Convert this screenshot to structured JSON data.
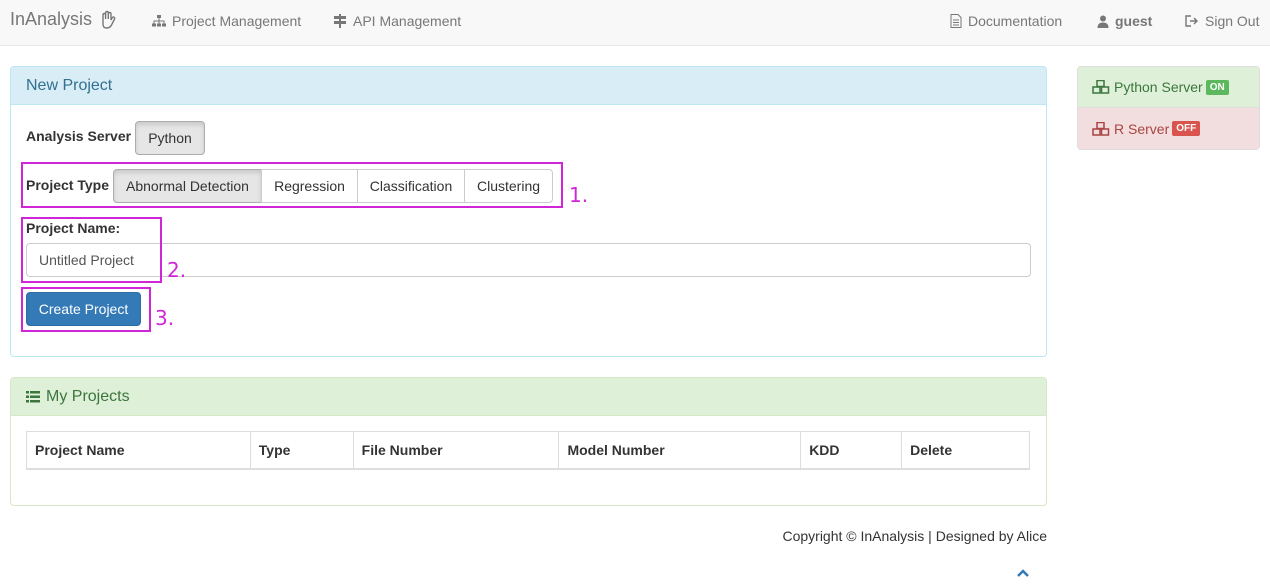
{
  "navbar": {
    "brand": "InAnalysis",
    "brand_icon": "hand-icon",
    "items": [
      {
        "label": "Project Management",
        "icon": "sitemap-icon"
      },
      {
        "label": "API Management",
        "icon": "signpost-icon"
      }
    ],
    "right": [
      {
        "label": "Documentation",
        "icon": "file-icon"
      },
      {
        "label": "guest",
        "icon": "user-icon"
      },
      {
        "label": "Sign Out",
        "icon": "sign-out-icon"
      }
    ]
  },
  "new_project": {
    "title": "New Project",
    "analysis_server_label": "Analysis Server",
    "analysis_server_button": "Python",
    "project_type_label": "Project Type",
    "project_types": [
      "Abnormal Detection",
      "Regression",
      "Classification",
      "Clustering"
    ],
    "project_type_selected": "Abnormal Detection",
    "project_name_label": "Project Name:",
    "project_name_value": "Untitled Project",
    "create_button": "Create Project"
  },
  "annotations": [
    "1.",
    "2.",
    "3."
  ],
  "my_projects": {
    "title": "My Projects",
    "columns": [
      "Project Name",
      "Type",
      "File Number",
      "Model Number",
      "KDD",
      "Delete"
    ]
  },
  "servers": {
    "python": {
      "label": "Python Server",
      "status": "ON"
    },
    "r": {
      "label": "R Server",
      "status": "OFF"
    }
  },
  "footer": "Copyright © InAnalysis | Designed by Alice",
  "colors": {
    "highlight": "#d126d8",
    "primary": "#337ab7",
    "on": "#5cb85c",
    "off": "#d9534f"
  }
}
